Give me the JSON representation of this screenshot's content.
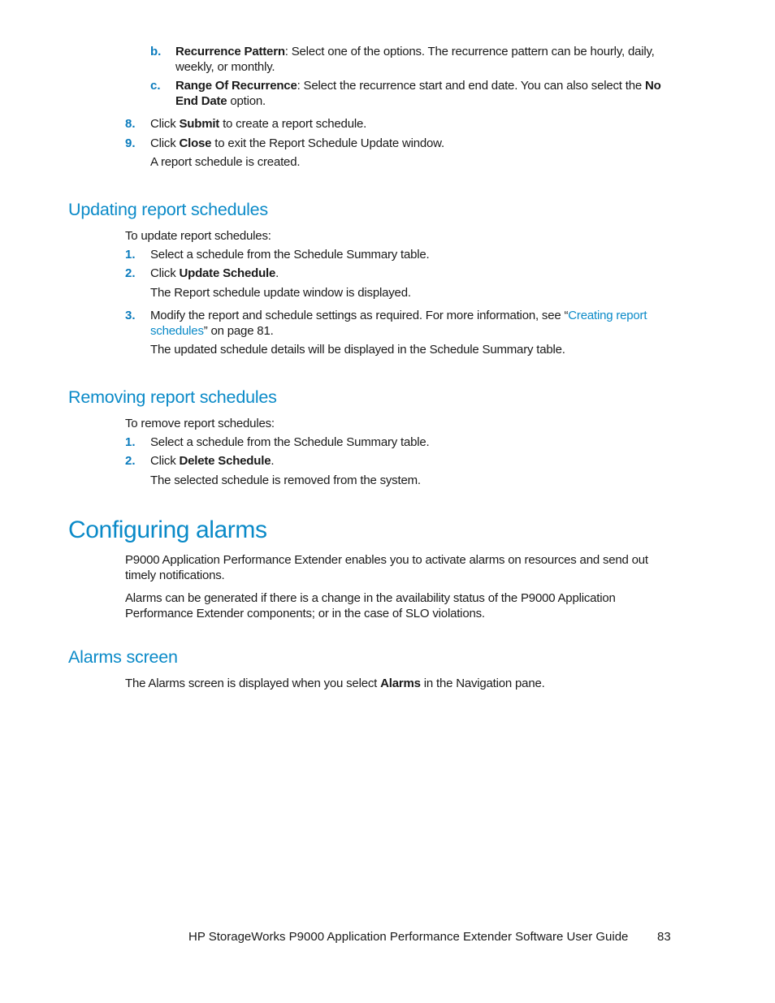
{
  "continuation": {
    "sub_items": [
      {
        "marker": "b.",
        "bold": "Recurrence Pattern",
        "text": ": Select one of the options. The recurrence pattern can be hourly, daily,",
        "text2": "weekly, or monthly."
      },
      {
        "marker": "c.",
        "bold": "Range Of Recurrence",
        "text": ": Select the recurrence start and end date. You can also select the ",
        "bold2": "No",
        "bold3": "End Date",
        "text2": " option."
      }
    ],
    "steps": [
      {
        "marker": "8.",
        "pre": "Click ",
        "bold": "Submit",
        "post": " to create a report schedule."
      },
      {
        "marker": "9.",
        "pre": "Click ",
        "bold": "Close",
        "post": " to exit the Report Schedule Update window.",
        "result": "A report schedule is created."
      }
    ]
  },
  "updating": {
    "heading": "Updating report schedules",
    "intro": "To update report schedules:",
    "steps": [
      {
        "marker": "1.",
        "text": "Select a schedule from the Schedule Summary table."
      },
      {
        "marker": "2.",
        "pre": "Click ",
        "bold": "Update Schedule",
        "post": ".",
        "result": "The Report schedule update window is displayed."
      },
      {
        "marker": "3.",
        "pre": "Modify the report and schedule settings as required. For more information, see “",
        "link1": "Creating report",
        "link2": "schedules",
        "post": "” on page 81.",
        "result": "The updated schedule details will be displayed in the Schedule Summary table."
      }
    ]
  },
  "removing": {
    "heading": "Removing report schedules",
    "intro": "To remove report schedules:",
    "steps": [
      {
        "marker": "1.",
        "text": "Select a schedule from the Schedule Summary table."
      },
      {
        "marker": "2.",
        "pre": "Click ",
        "bold": "Delete Schedule",
        "post": ".",
        "result": "The selected schedule is removed from the system."
      }
    ]
  },
  "configuring": {
    "heading": "Configuring alarms",
    "para1_line1": "P9000 Application Performance Extender enables you to activate alarms on resources and send out",
    "para1_line2": "timely notifications.",
    "para2_line1": "Alarms can be generated if there is a change in the availability status of the P9000 Application",
    "para2_line2": "Performance Extender components; or in the case of SLO violations."
  },
  "alarms_screen": {
    "heading": "Alarms screen",
    "pre": "The Alarms screen is displayed when you select ",
    "bold": "Alarms",
    "post": " in the Navigation pane."
  },
  "footer": {
    "title": "HP StorageWorks P9000 Application Performance Extender Software User Guide",
    "page_number": "83"
  }
}
